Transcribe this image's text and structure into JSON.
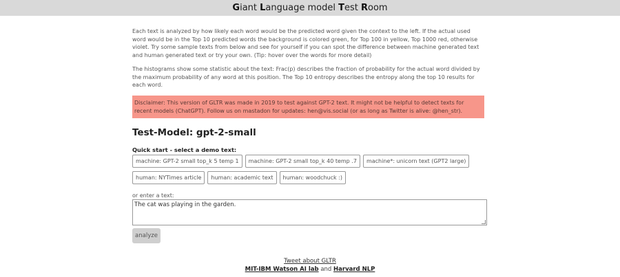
{
  "header": {
    "title_parts": [
      {
        "initial": "G",
        "rest": "iant "
      },
      {
        "initial": "L",
        "rest": "anguage model "
      },
      {
        "initial": "T",
        "rest": "est "
      },
      {
        "initial": "R",
        "rest": "oom"
      }
    ]
  },
  "intro": {
    "paragraph1": "Each text is analyzed by how likely each word would be the predicted word given the context to the left. If the actual used word would be in the Top 10 predicted words the background is colored green, for Top 100 in yellow, Top 1000 red, otherwise violet. Try some sample texts from below and see for yourself if you can spot the difference between machine generated text and human generated text or try your own. (Tip: hover over the words for more detail)",
    "paragraph2": "The histograms show some statistic about the text: Frac(p) describes the fraction of probability for the actual word divided by the maximum probability of any word at this position. The Top 10 entropy describes the entropy along the top 10 results for each word."
  },
  "disclaimer": {
    "text": "Disclaimer: This version of GLTR was made in 2019 to test against GPT-2 text. It might not be helpful to detect texts for recent models (ChatGPT). Follow us on mastadon for updates: hen@vis.social (or as long as Twitter is alive: @hen_str).",
    "color": "#f7968a"
  },
  "model": {
    "title": "Test-Model: gpt-2-small"
  },
  "quick_start": {
    "label": "Quick start - select a demo text:",
    "demos": [
      "machine: GPT-2 small top_k 5 temp 1",
      "machine: GPT-2 small top_k 40 temp .7",
      "machine*: unicorn text (GPT2 large)",
      "human: NYTimes article",
      "human: academic text",
      "human: woodchuck :)"
    ]
  },
  "input": {
    "label": "or enter a text:",
    "value": "The cat was playing in the garden."
  },
  "analyze": {
    "label": "analyze"
  },
  "footer": {
    "tweet": "Tweet about GLTR",
    "lab": "MIT-IBM Watson AI lab",
    "and": "and",
    "nlp": "Harvard NLP"
  }
}
